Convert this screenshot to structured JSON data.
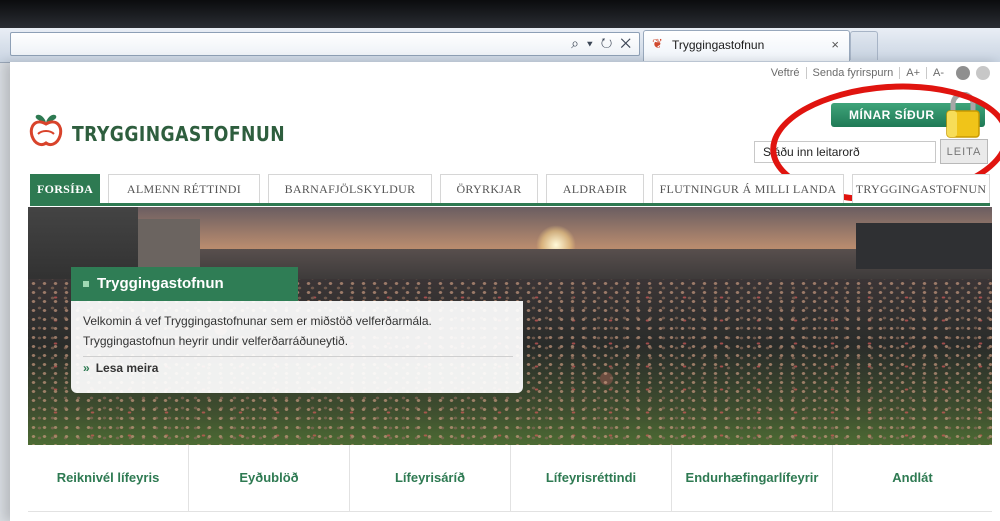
{
  "browser": {
    "tab_title": "Tryggingastofnun",
    "tab_close": "×",
    "addr_controls": "⌕ ▾ ↻ ✕"
  },
  "utility": {
    "items": [
      "Veftré",
      "Senda fyrirspurn",
      "A+",
      "A-"
    ]
  },
  "brand": {
    "name": "TRYGGINGASTOFNUN",
    "accent": "#2e7a52",
    "logo_red": "#d8432b"
  },
  "account": {
    "my_pages": "MÍNAR SÍÐUR"
  },
  "search": {
    "placeholder": "Sláðu inn leitarorð",
    "button": "LEITA"
  },
  "nav": {
    "items": [
      {
        "label": "FORSÍÐA",
        "active": true
      },
      {
        "label": "ALMENN RÉTTINDI"
      },
      {
        "label": "BARNAFJÖLSKYLDUR"
      },
      {
        "label": "ÖRYRKJAR"
      },
      {
        "label": "ALDRAÐIR"
      },
      {
        "label": "FLUTNINGUR Á MILLI LANDA"
      },
      {
        "label": "TRYGGINGASTOFNUN"
      }
    ]
  },
  "hero": {
    "title": "Tryggingastofnun",
    "line1": "Velkomin á vef Tryggingastofnunar sem er miðstöð velferðarmála.",
    "line2": "Tryggingastofnun heyrir undir velferðarráðuneytið.",
    "more_icon": "»",
    "more": "Lesa meira"
  },
  "quick_links": [
    "Reiknivél lífeyris",
    "Eyðublöð",
    "Lífeyrisáríð",
    "Lífeyrisréttindi",
    "Endurhæfingarlífeyrir",
    "Andlát"
  ]
}
